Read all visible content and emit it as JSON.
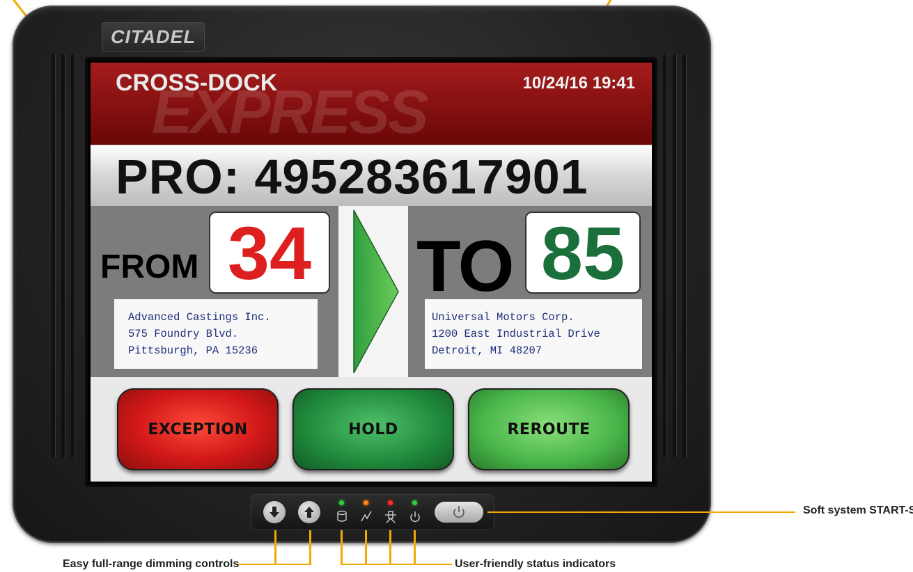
{
  "brand": {
    "logo_text": "CITADEL"
  },
  "screen": {
    "header": {
      "title": "CROSS-DOCK",
      "watermark": "EXPRESS",
      "datetime": "10/24/16 19:41"
    },
    "pro": {
      "text": "PRO: 495283617901"
    },
    "from": {
      "label": "FROM",
      "door": "34",
      "address": [
        "Advanced Castings Inc.",
        "575 Foundry Blvd.",
        "Pittsburgh, PA  15236"
      ]
    },
    "to": {
      "label": "TO",
      "door": "85",
      "address": [
        "Universal Motors Corp.",
        "1200 East Industrial Drive",
        "Detroit, MI  48207"
      ]
    },
    "buttons": {
      "exception": "EXCEPTION",
      "hold": "HOLD",
      "reroute": "REROUTE"
    }
  },
  "controls": {
    "dim_down_icon": "dim-down-icon",
    "dim_up_icon": "dim-up-icon",
    "indicators": [
      {
        "icon": "storage-icon",
        "led_color": "#2ecc40"
      },
      {
        "icon": "activity-icon",
        "led_color": "#ff851b"
      },
      {
        "icon": "network-icon",
        "led_color": "#ff2a2a"
      },
      {
        "icon": "power-status-icon",
        "led_color": "#2ecc40"
      }
    ],
    "power_icon": "power-icon"
  },
  "callouts": {
    "start_stop": "Soft system START-STOP",
    "dimming": "Easy full-range dimming controls",
    "status": "User-friendly status indicators"
  },
  "colors": {
    "from_number": "#dd1f1f",
    "to_number": "#1b6f3a",
    "header_red": "#8a1212",
    "callout_line": "#f2a900"
  }
}
